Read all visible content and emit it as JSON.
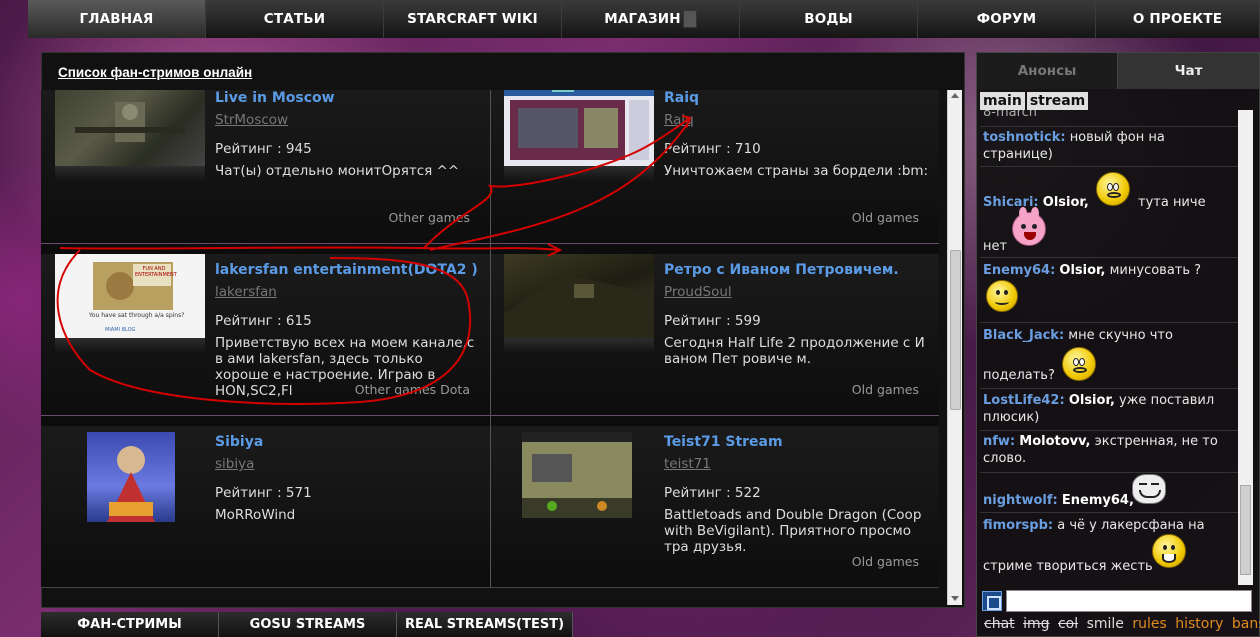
{
  "nav": {
    "items": [
      "ГЛАВНАЯ",
      "СТАТЬИ",
      "STARCRAFT WIKI",
      "МАГАЗИН",
      "ВОДЫ",
      "ФОРУМ",
      "О ПРОЕКТЕ"
    ],
    "active": "ГЛАВНАЯ"
  },
  "panel_title": "Список фан-стримов онлайн",
  "streams": [
    {
      "title": "Live in Moscow",
      "user": "StrMoscow",
      "rating": "Рейтинг : 945",
      "desc": "Чат(ы) отдельно монитОрятся ^^",
      "category": "Other games"
    },
    {
      "title": "Raiq",
      "user": "Raiq",
      "rating": "Рейтинг : 710",
      "desc": "Уничтожаем страны за бордели :bm:",
      "category": "Old games"
    },
    {
      "title": "lakersfan entertainment(DOTA2 )",
      "user": "lakersfan",
      "rating": "Рейтинг : 615",
      "desc": "Приветствую всех на моем канале,с в ами lakersfan, здесь только хороше е настроение. Играю в HON,SC2,Fl",
      "category": "Other games Dota"
    },
    {
      "title": "Ретро с Иваном Петровичем.",
      "user": "ProudSoul",
      "rating": "Рейтинг : 599",
      "desc": "Сегодня Half Life 2 продолжение с И ваном Пет ровиче м.",
      "category": "Old games"
    },
    {
      "title": "Sibiya",
      "user": "sibiya",
      "rating": "Рейтинг : 571",
      "desc": "MoRRoWind",
      "category": ""
    },
    {
      "title": "Teist71 Stream",
      "user": "teist71",
      "rating": "Рейтинг : 522",
      "desc": "Battletoads and Double Dragon (Coop with BeVigilant). Приятного просмо тра друзья.",
      "category": "Old games"
    }
  ],
  "thumb_texts": {
    "lakers_top": "FUN AND ENTERTAINMENT",
    "lakers_bottom": "You have sat through a/a spins?",
    "lakers_links": "MIAMI   BLOG"
  },
  "bottom_tabs": [
    "ФАН-СТРИМЫ",
    "GOSU STREAMS",
    "REAL STREAMS(TEST)"
  ],
  "right_tabs": {
    "announce": "Анонсы",
    "chat": "Чат"
  },
  "chat_channels": [
    "main",
    "stream"
  ],
  "chat_partial": "8-march",
  "chat": [
    {
      "nick": "toshnotick:",
      "text": "новый фон на странице)"
    },
    {
      "nick": "Shicari:",
      "at": "Olsior,",
      "text": "тута ниче",
      "text2": "нет"
    },
    {
      "nick": "Enemy64:",
      "at": "Olsior,",
      "text": "минусовать ?"
    },
    {
      "nick": "Black_Jack:",
      "text": "мне скучно что",
      "text2": "поделать?"
    },
    {
      "nick": "LostLife42:",
      "at": "Olsior,",
      "text": "уже поставил плюсик)"
    },
    {
      "nick": "nfw:",
      "at": "Molotovv,",
      "text": "экстренная, не то слово."
    },
    {
      "nick": "nightwolf:",
      "at": "Enemy64,",
      "text": ""
    },
    {
      "nick": "fimorspb:",
      "text": "а чё у лакерсфана на",
      "text2": "стриме твориться жесть"
    }
  ],
  "chat_tools": [
    "chat",
    "img",
    "col",
    "smile",
    "rules",
    "history",
    "bans"
  ],
  "colors": {
    "link": "#5b9be6",
    "nick": "#6a9ee0",
    "annotation": "#d40000",
    "orange": "#e08a20"
  }
}
